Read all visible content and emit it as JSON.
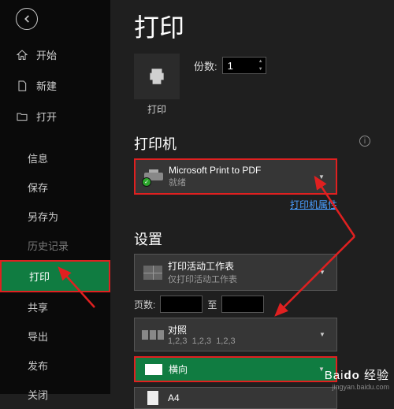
{
  "sidebar": {
    "home": "开始",
    "new": "新建",
    "open": "打开",
    "info": "信息",
    "save": "保存",
    "saveas": "另存为",
    "history": "历史记录",
    "print": "打印",
    "share": "共享",
    "export": "导出",
    "publish": "发布",
    "close": "关闭"
  },
  "main": {
    "title": "打印",
    "print_button": "打印",
    "copies_label": "份数:",
    "copies_value": "1",
    "printer_heading": "打印机",
    "printer_name": "Microsoft Print to PDF",
    "printer_status": "就绪",
    "printer_props": "打印机属性",
    "settings_heading": "设置",
    "scope_title": "打印活动工作表",
    "scope_sub": "仅打印活动工作表",
    "pages_label": "页数:",
    "pages_to": "至",
    "collate_title": "对照",
    "collate_sub1": "1,2,3",
    "collate_sub2": "1,2,3",
    "collate_sub3": "1,2,3",
    "orientation": "横向",
    "paper": "A4"
  },
  "watermark": {
    "line1a": "Bai",
    "line1b": "经验",
    "line2": "jingyan.baidu.com"
  }
}
